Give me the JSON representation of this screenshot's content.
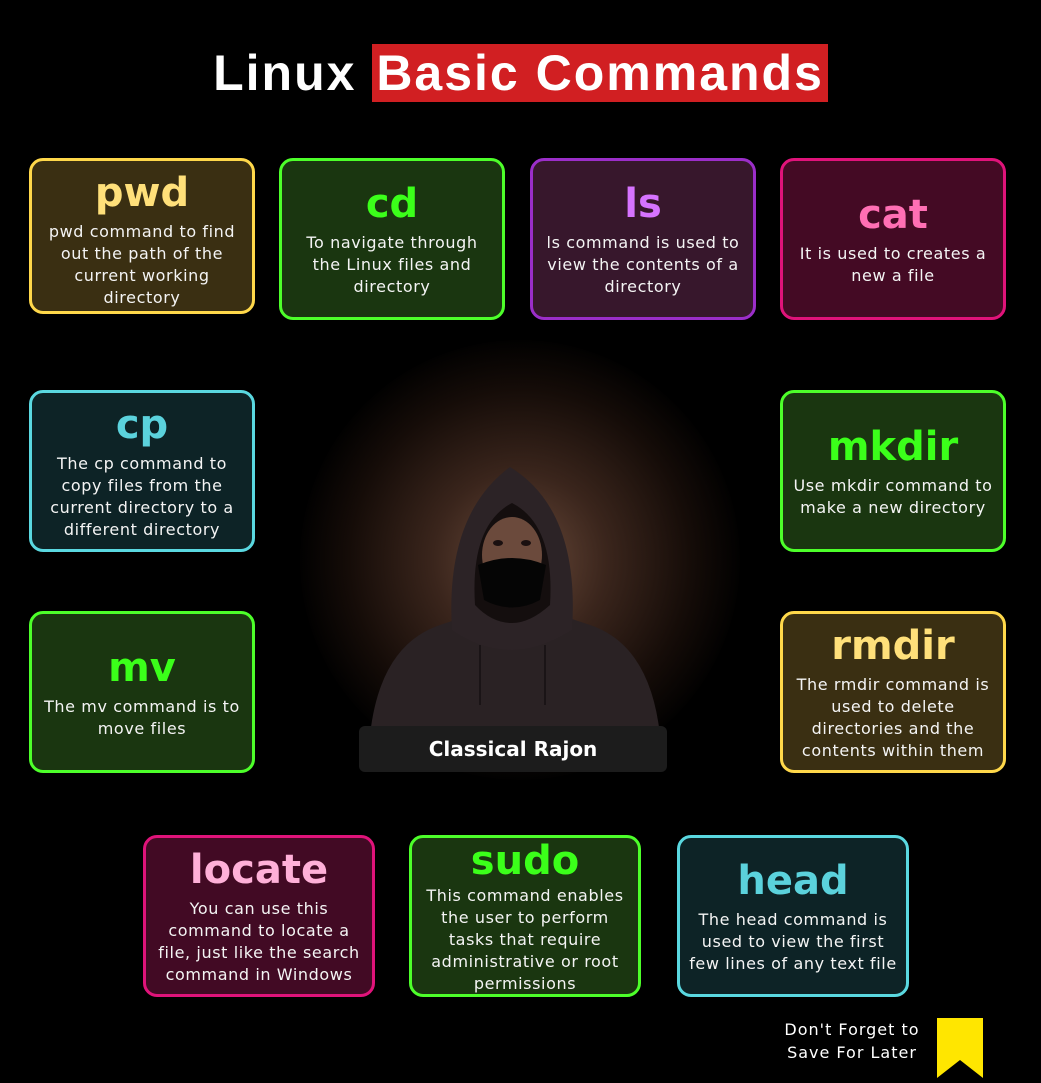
{
  "title": {
    "part1": "Linux ",
    "part2": "Basic Commands"
  },
  "cards": [
    {
      "cmd": "pwd",
      "desc": "pwd command to find out the path of the current working directory"
    },
    {
      "cmd": "cd",
      "desc": "To navigate through the Linux files and directory"
    },
    {
      "cmd": "ls",
      "desc": "ls command is used to view the contents of a directory"
    },
    {
      "cmd": "cat",
      "desc": "It is used to creates a new a file"
    },
    {
      "cmd": "cp",
      "desc": "The cp command to copy files from the current directory to a different directory"
    },
    {
      "cmd": "mkdir",
      "desc": "Use mkdir command to make a new directory"
    },
    {
      "cmd": "mv",
      "desc": "The mv command is to move files"
    },
    {
      "cmd": "rmdir",
      "desc": "The rmdir command is used to delete directories and the contents within them"
    },
    {
      "cmd": "locate",
      "desc": "You can use this command to locate a file, just like the search command in Windows"
    },
    {
      "cmd": "sudo",
      "desc": "This command enables the user to perform tasks that require administrative or root permissions"
    },
    {
      "cmd": "head",
      "desc": "The head command is used to view the first few lines of any text file"
    }
  ],
  "author": {
    "name": "Classical Rajon"
  },
  "footer": {
    "line1": "Don't Forget to",
    "line2": "Save For  Later",
    "icon": "bookmark-icon"
  },
  "colors": {
    "title_highlight": "#d11f22",
    "bookmark": "#ffe600"
  }
}
